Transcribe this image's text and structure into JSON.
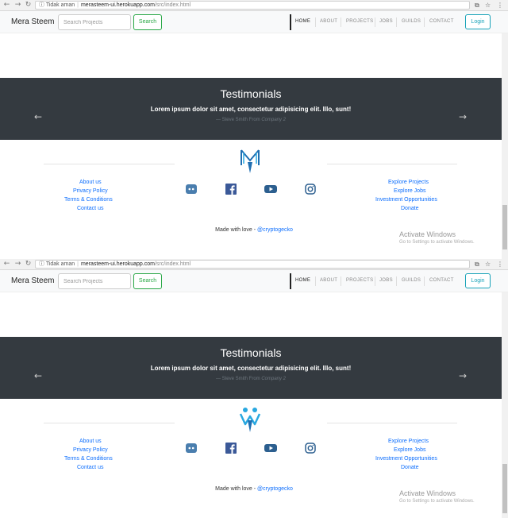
{
  "browser": {
    "security_label": "Tidak aman",
    "url_host": "merasteem-ui.herokuapp.com",
    "url_path": "/src/index.html"
  },
  "navbar": {
    "brand": "Mera Steem",
    "search_placeholder": "Search Projects",
    "search_button": "Search",
    "links": [
      "HOME",
      "ABOUT",
      "PROJECTS",
      "JOBS",
      "GUILDS",
      "CONTACT"
    ],
    "login": "Login"
  },
  "testimonials": {
    "title": "Testimonials",
    "quote": "Lorem ipsum dolor sit amet, consectetur adipisicing elit. Illo, sunt!",
    "author_prefix": "— Steve Smith From ",
    "author_company": "Company 2",
    "prev_arrow": "←",
    "next_arrow": "→"
  },
  "footer": {
    "left_links": [
      "About us",
      "Privacy Policy",
      "Terms & Conditions",
      "Contact us"
    ],
    "right_links": [
      "Explore Projects",
      "Explore Jobs",
      "Investment Opportunities",
      "Donate"
    ],
    "social_icons": [
      "discord-icon",
      "facebook-icon",
      "youtube-icon",
      "instagram-icon"
    ],
    "made_with_prefix": "Made with love - ",
    "made_with_handle": "@cryptogecko"
  },
  "watermark": {
    "title": "Activate Windows",
    "subtitle": "Go to Settings to activate Windows."
  },
  "colors": {
    "accent_link": "#0d6efd",
    "testimonial_bg": "#343a40",
    "search_green": "#28a745",
    "login_teal": "#17a2b8",
    "logo_blue_dark": "#1f6fb2",
    "logo_blue_light": "#29a8e0"
  }
}
